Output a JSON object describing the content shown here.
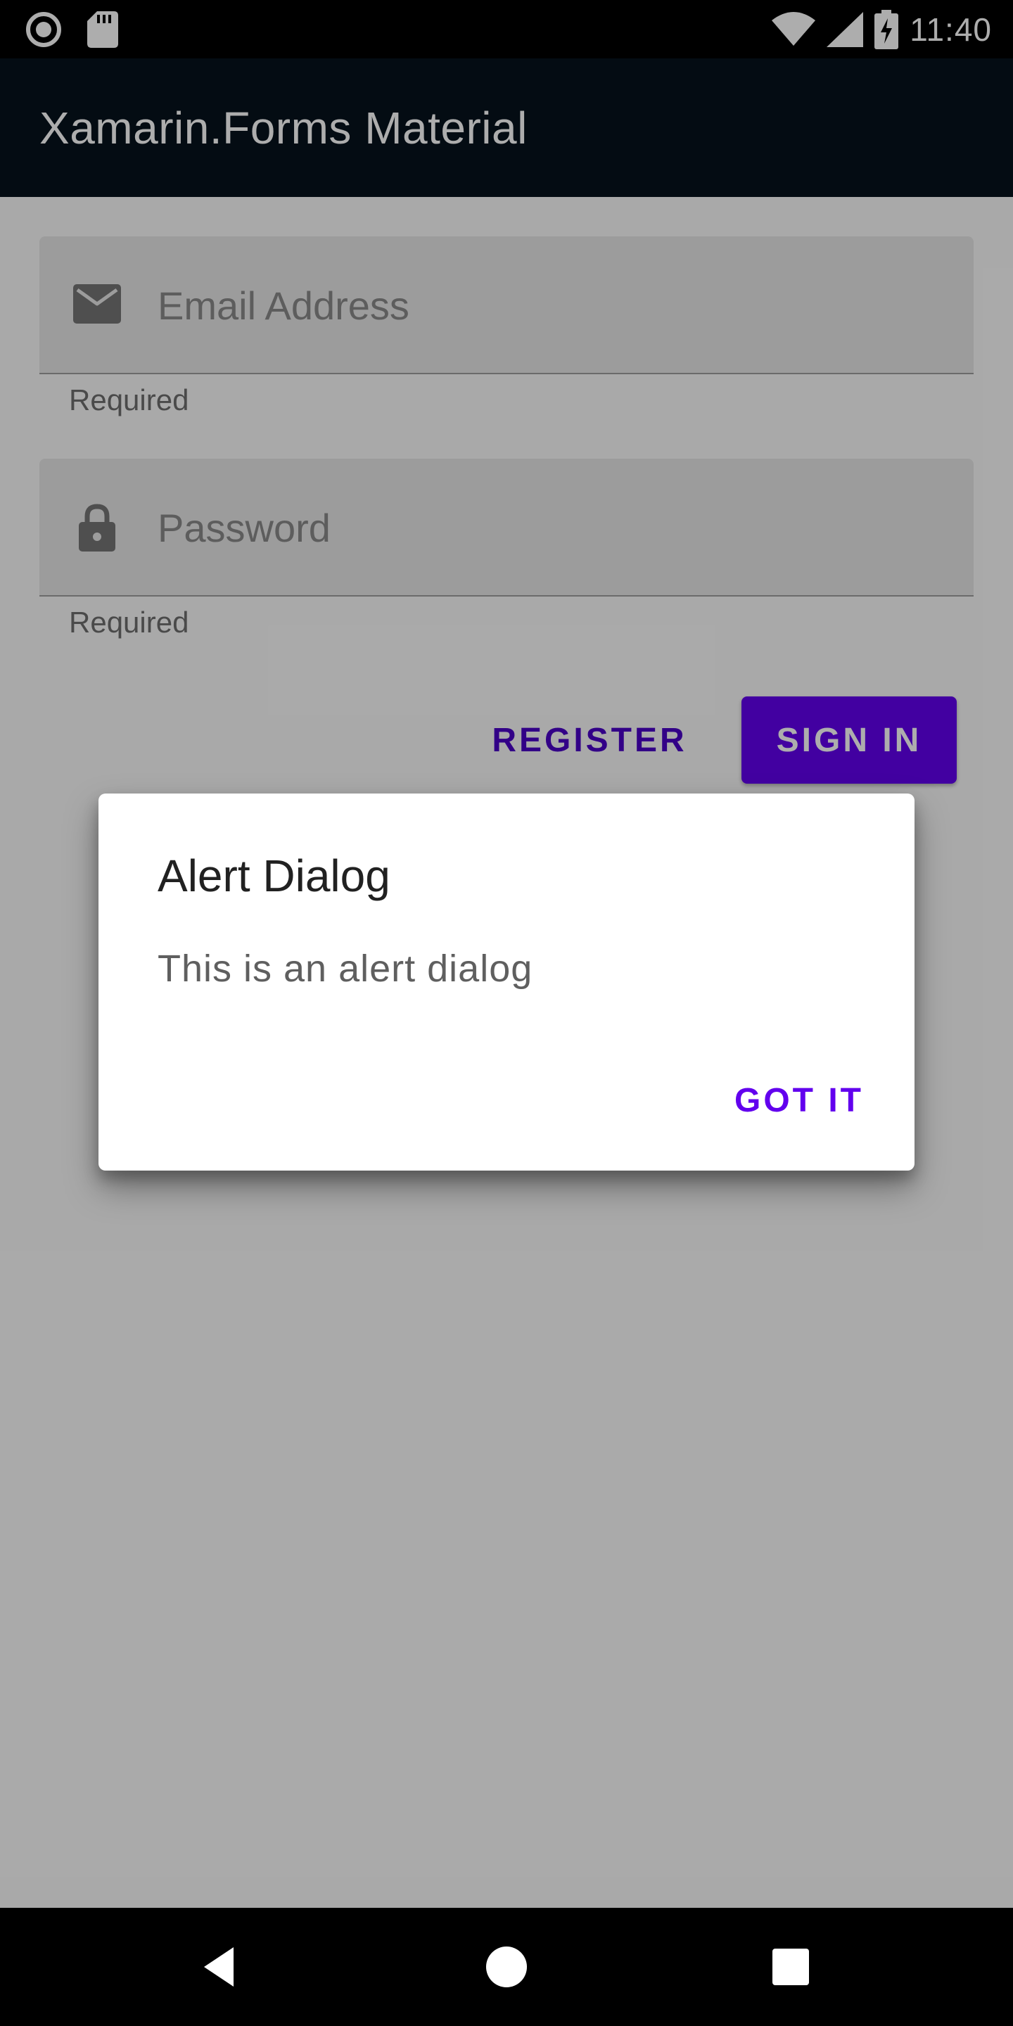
{
  "status_bar": {
    "time": "11:40",
    "icons": [
      "record-icon",
      "sd-card-icon",
      "wifi-icon",
      "signal-icon",
      "battery-charging-icon"
    ]
  },
  "app_bar": {
    "title": "Xamarin.Forms Material"
  },
  "form": {
    "email": {
      "icon": "mail-icon",
      "placeholder": "Email Address",
      "value": "",
      "helper": "Required"
    },
    "password": {
      "icon": "lock-icon",
      "placeholder": "Password",
      "value": "",
      "helper": "Required"
    },
    "register_label": "REGISTER",
    "signin_label": "SIGN IN"
  },
  "dialog": {
    "title": "Alert Dialog",
    "message": "This is an alert dialog",
    "action_label": "GOT IT"
  },
  "nav_bar": {
    "buttons": [
      "back-icon",
      "home-icon",
      "recents-icon"
    ]
  },
  "colors": {
    "primary": "#6200ee",
    "app_bar": "#06131d",
    "scrim": "rgba(0,0,0,0.32)"
  }
}
